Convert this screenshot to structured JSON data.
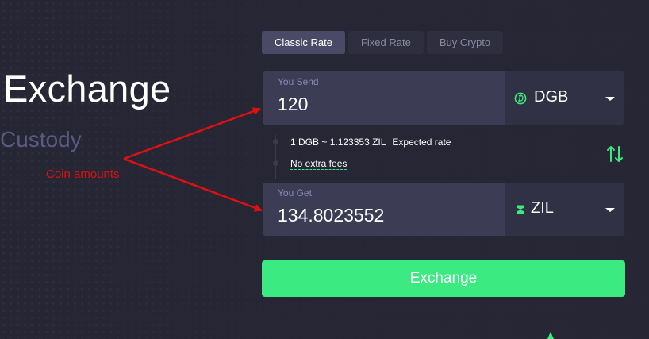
{
  "hero": {
    "title": "Exchange",
    "subtitle": "Custody"
  },
  "annotation": {
    "label": "Coin amounts",
    "color": "#e01010"
  },
  "tabs": [
    {
      "label": "Classic Rate",
      "active": true
    },
    {
      "label": "Fixed Rate",
      "active": false
    },
    {
      "label": "Buy Crypto",
      "active": false
    }
  ],
  "send": {
    "label": "You Send",
    "amount": "120",
    "currency": "DGB",
    "icon": "dgb-coin-icon"
  },
  "rate": {
    "text": "1 DGB ~ 1.123353 ZIL",
    "expected_label": "Expected rate",
    "fees_label": "No extra fees"
  },
  "get": {
    "label": "You Get",
    "amount": "134.8023552",
    "currency": "ZIL",
    "icon": "zil-coin-icon"
  },
  "action": {
    "exchange_label": "Exchange"
  },
  "colors": {
    "background": "#262635",
    "accent": "#3bea80",
    "field_bg": "#3c3c55",
    "currency_bg": "#313145",
    "tab_active": "#4a4a66",
    "subtitle": "#5a5a82"
  }
}
